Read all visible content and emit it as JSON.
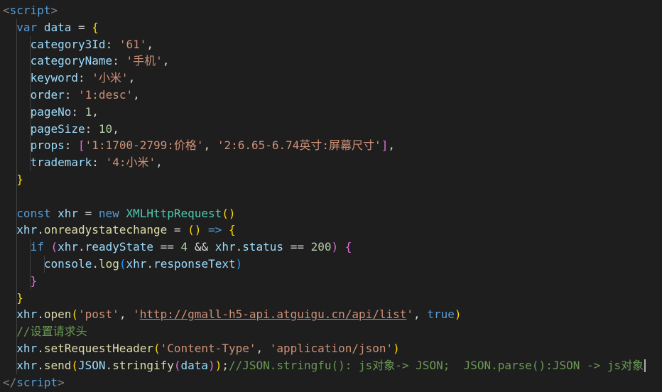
{
  "editor": {
    "lines": [
      {
        "indent": 0,
        "tokens": [
          {
            "t": "<",
            "c": "pun"
          },
          {
            "t": "script",
            "c": "tag"
          },
          {
            "t": ">",
            "c": "pun"
          }
        ]
      },
      {
        "indent": 1,
        "tokens": [
          {
            "t": "var ",
            "c": "kw"
          },
          {
            "t": "data",
            "c": "var"
          },
          {
            "t": " = ",
            "c": "op"
          },
          {
            "t": "{",
            "c": "b1"
          }
        ]
      },
      {
        "indent": 2,
        "tokens": [
          {
            "t": "category3Id",
            "c": "var"
          },
          {
            "t": ": ",
            "c": "op"
          },
          {
            "t": "'61'",
            "c": "str"
          },
          {
            "t": ",",
            "c": "op"
          }
        ]
      },
      {
        "indent": 2,
        "tokens": [
          {
            "t": "categoryName",
            "c": "var"
          },
          {
            "t": ": ",
            "c": "op"
          },
          {
            "t": "'手机'",
            "c": "str"
          },
          {
            "t": ",",
            "c": "op"
          }
        ]
      },
      {
        "indent": 2,
        "tokens": [
          {
            "t": "keyword",
            "c": "var"
          },
          {
            "t": ": ",
            "c": "op"
          },
          {
            "t": "'小米'",
            "c": "str"
          },
          {
            "t": ",",
            "c": "op"
          }
        ]
      },
      {
        "indent": 2,
        "tokens": [
          {
            "t": "order",
            "c": "var"
          },
          {
            "t": ": ",
            "c": "op"
          },
          {
            "t": "'1:desc'",
            "c": "str"
          },
          {
            "t": ",",
            "c": "op"
          }
        ]
      },
      {
        "indent": 2,
        "tokens": [
          {
            "t": "pageNo",
            "c": "var"
          },
          {
            "t": ": ",
            "c": "op"
          },
          {
            "t": "1",
            "c": "num"
          },
          {
            "t": ",",
            "c": "op"
          }
        ]
      },
      {
        "indent": 2,
        "tokens": [
          {
            "t": "pageSize",
            "c": "var"
          },
          {
            "t": ": ",
            "c": "op"
          },
          {
            "t": "10",
            "c": "num"
          },
          {
            "t": ",",
            "c": "op"
          }
        ]
      },
      {
        "indent": 2,
        "tokens": [
          {
            "t": "props",
            "c": "var"
          },
          {
            "t": ": ",
            "c": "op"
          },
          {
            "t": "[",
            "c": "b2"
          },
          {
            "t": "'1:1700-2799:价格'",
            "c": "str"
          },
          {
            "t": ", ",
            "c": "op"
          },
          {
            "t": "'2:6.65-6.74英寸:屏幕尺寸'",
            "c": "str"
          },
          {
            "t": "]",
            "c": "b2"
          },
          {
            "t": ",",
            "c": "op"
          }
        ]
      },
      {
        "indent": 2,
        "tokens": [
          {
            "t": "trademark",
            "c": "var"
          },
          {
            "t": ": ",
            "c": "op"
          },
          {
            "t": "'4:小米'",
            "c": "str"
          },
          {
            "t": ",",
            "c": "op"
          }
        ]
      },
      {
        "indent": 1,
        "tokens": [
          {
            "t": "}",
            "c": "b1"
          }
        ]
      },
      {
        "indent": 1,
        "tokens": []
      },
      {
        "indent": 1,
        "tokens": [
          {
            "t": "const ",
            "c": "kw"
          },
          {
            "t": "xhr",
            "c": "var"
          },
          {
            "t": " = ",
            "c": "op"
          },
          {
            "t": "new ",
            "c": "kw"
          },
          {
            "t": "XMLHttpRequest",
            "c": "cls"
          },
          {
            "t": "()",
            "c": "b1"
          }
        ]
      },
      {
        "indent": 1,
        "tokens": [
          {
            "t": "xhr",
            "c": "var"
          },
          {
            "t": ".",
            "c": "op"
          },
          {
            "t": "onreadystatechange",
            "c": "fn"
          },
          {
            "t": " = ",
            "c": "op"
          },
          {
            "t": "()",
            "c": "b1"
          },
          {
            "t": " => ",
            "c": "kw"
          },
          {
            "t": "{",
            "c": "b1"
          }
        ]
      },
      {
        "indent": 2,
        "tokens": [
          {
            "t": "if ",
            "c": "kw"
          },
          {
            "t": "(",
            "c": "b2"
          },
          {
            "t": "xhr",
            "c": "var"
          },
          {
            "t": ".",
            "c": "op"
          },
          {
            "t": "readyState",
            "c": "var"
          },
          {
            "t": " == ",
            "c": "op"
          },
          {
            "t": "4",
            "c": "num"
          },
          {
            "t": " && ",
            "c": "op"
          },
          {
            "t": "xhr",
            "c": "var"
          },
          {
            "t": ".",
            "c": "op"
          },
          {
            "t": "status",
            "c": "var"
          },
          {
            "t": " == ",
            "c": "op"
          },
          {
            "t": "200",
            "c": "num"
          },
          {
            "t": ")",
            "c": "b2"
          },
          {
            "t": " ",
            "c": "op"
          },
          {
            "t": "{",
            "c": "b2"
          }
        ]
      },
      {
        "indent": 3,
        "tokens": [
          {
            "t": "console",
            "c": "var"
          },
          {
            "t": ".",
            "c": "op"
          },
          {
            "t": "log",
            "c": "fn"
          },
          {
            "t": "(",
            "c": "b3"
          },
          {
            "t": "xhr",
            "c": "var"
          },
          {
            "t": ".",
            "c": "op"
          },
          {
            "t": "responseText",
            "c": "var"
          },
          {
            "t": ")",
            "c": "b3"
          }
        ]
      },
      {
        "indent": 2,
        "tokens": [
          {
            "t": "}",
            "c": "b2"
          }
        ]
      },
      {
        "indent": 1,
        "tokens": [
          {
            "t": "}",
            "c": "b1"
          }
        ]
      },
      {
        "indent": 1,
        "tokens": [
          {
            "t": "xhr",
            "c": "var"
          },
          {
            "t": ".",
            "c": "op"
          },
          {
            "t": "open",
            "c": "fn"
          },
          {
            "t": "(",
            "c": "b1"
          },
          {
            "t": "'post'",
            "c": "str"
          },
          {
            "t": ", ",
            "c": "op"
          },
          {
            "t": "'",
            "c": "str"
          },
          {
            "t": "http://gmall-h5-api.atguigu.cn/api/list",
            "c": "link"
          },
          {
            "t": "'",
            "c": "str"
          },
          {
            "t": ", ",
            "c": "op"
          },
          {
            "t": "true",
            "c": "kw"
          },
          {
            "t": ")",
            "c": "b1"
          }
        ]
      },
      {
        "indent": 1,
        "tokens": [
          {
            "t": "//设置请求头",
            "c": "cmt"
          }
        ]
      },
      {
        "indent": 1,
        "tokens": [
          {
            "t": "xhr",
            "c": "var"
          },
          {
            "t": ".",
            "c": "op"
          },
          {
            "t": "setRequestHeader",
            "c": "fn"
          },
          {
            "t": "(",
            "c": "b1"
          },
          {
            "t": "'Content-Type'",
            "c": "str"
          },
          {
            "t": ", ",
            "c": "op"
          },
          {
            "t": "'application/json'",
            "c": "str"
          },
          {
            "t": ")",
            "c": "b1"
          }
        ]
      },
      {
        "indent": 1,
        "cursor": true,
        "tokens": [
          {
            "t": "xhr",
            "c": "var"
          },
          {
            "t": ".",
            "c": "op"
          },
          {
            "t": "send",
            "c": "fn"
          },
          {
            "t": "(",
            "c": "b1"
          },
          {
            "t": "JSON",
            "c": "var"
          },
          {
            "t": ".",
            "c": "op"
          },
          {
            "t": "stringify",
            "c": "fn"
          },
          {
            "t": "(",
            "c": "b2"
          },
          {
            "t": "data",
            "c": "var"
          },
          {
            "t": ")",
            "c": "b2"
          },
          {
            "t": ")",
            "c": "b1"
          },
          {
            "t": ";",
            "c": "op"
          },
          {
            "t": "//JSON.stringfu(): js对象-> JSON;  JSON.parse():JSON -> js对象",
            "c": "cmt"
          }
        ]
      },
      {
        "indent": 0,
        "tokens": [
          {
            "t": "</",
            "c": "pun"
          },
          {
            "t": "script",
            "c": "tag"
          },
          {
            "t": ">",
            "c": "pun"
          }
        ]
      }
    ]
  }
}
